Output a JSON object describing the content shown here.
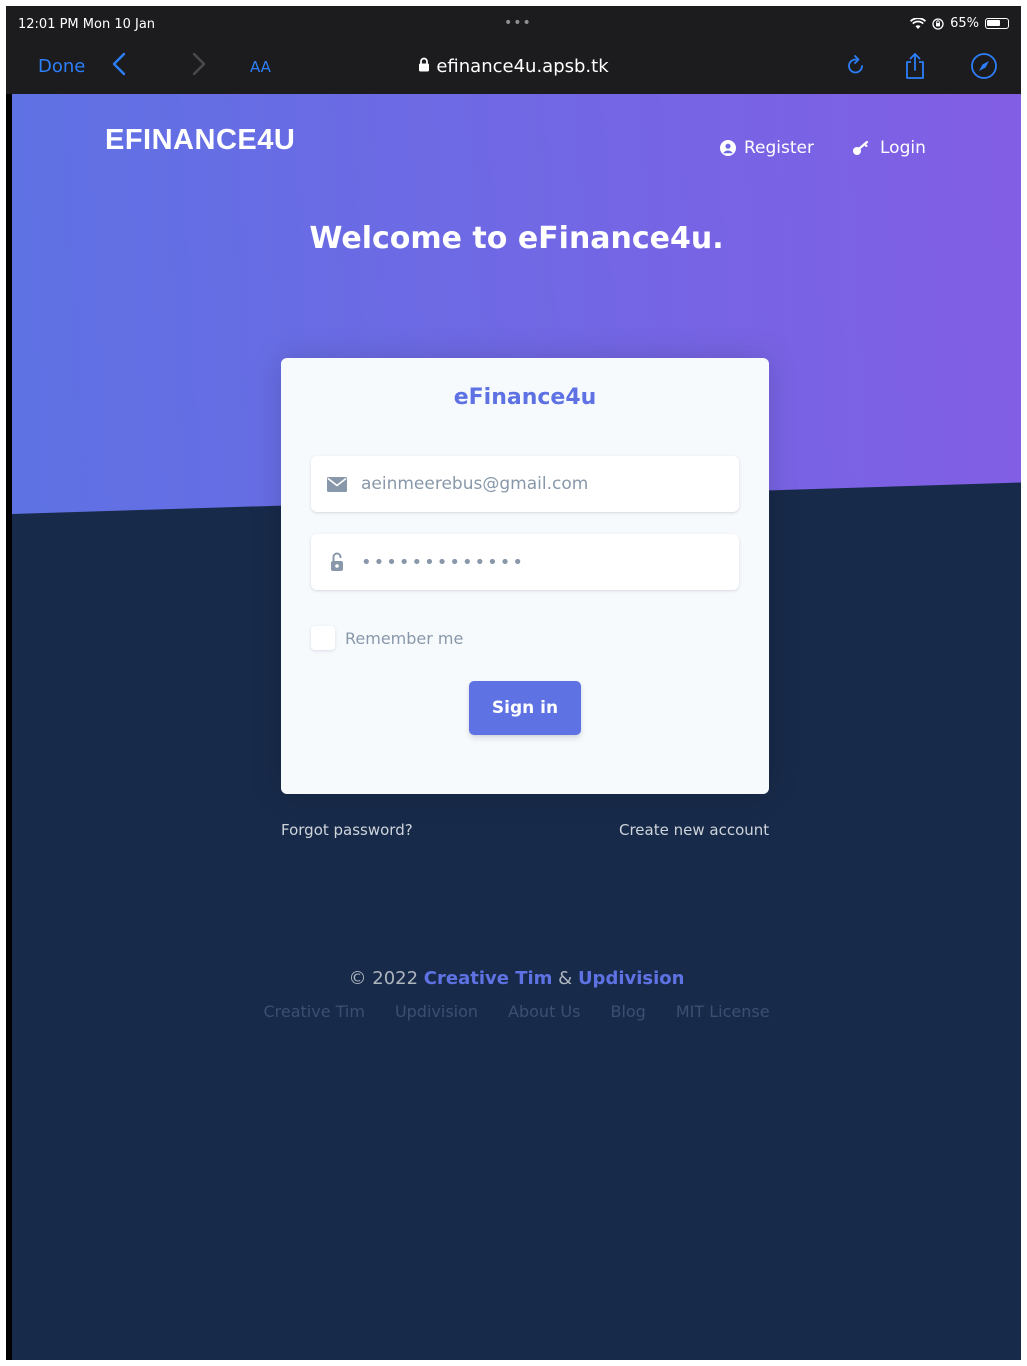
{
  "status_bar": {
    "time": "12:01 PM  Mon 10 Jan",
    "dots": "•••",
    "battery_percent": "65%"
  },
  "browser": {
    "done_label": "Done",
    "text_size_label": "AA",
    "url": "efinance4u.apsb.tk",
    "accent_color": "#2d7ff9"
  },
  "navbar": {
    "brand": "EFINANCE4U",
    "register_label": "Register",
    "login_label": "Login"
  },
  "hero": {
    "welcome": "Welcome to eFinance4u.",
    "gradient_start": "#5e72e4",
    "gradient_end": "#825ee4"
  },
  "login_card": {
    "title": "eFinance4u",
    "email_value": "aeinmeerebus@gmail.com",
    "password_value": "•••••••••••••",
    "remember_label": "Remember me",
    "signin_label": "Sign in"
  },
  "links": {
    "forgot_password": "Forgot password?",
    "create_account": "Create new account"
  },
  "footer": {
    "copyright_prefix": "© 2022",
    "link1": "Creative Tim",
    "amp": "&",
    "link2": "Updivision",
    "nav": [
      "Creative Tim",
      "Updivision",
      "About Us",
      "Blog",
      "MIT License"
    ]
  },
  "colors": {
    "primary": "#5e72e4",
    "background_dark": "#182a4a"
  }
}
